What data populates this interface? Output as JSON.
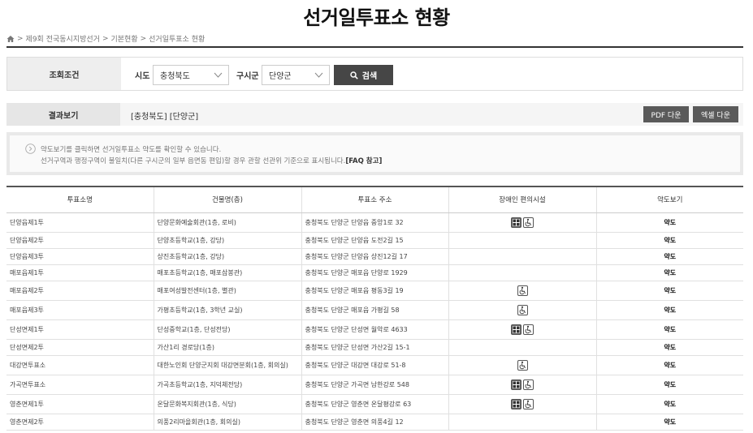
{
  "page": {
    "title": "선거일투표소 현황"
  },
  "breadcrumb": [
    "제9회 전국동시지방선거",
    "기본현황",
    "선거일투표소 현황"
  ],
  "search": {
    "label": "조회조건",
    "sido_label": "시도",
    "sido_value": "충청북도",
    "sigungu_label": "구시군",
    "sigungu_value": "단양군",
    "button_label": "검색"
  },
  "result": {
    "label": "결과보기",
    "region": "[충청북도] [단양군]",
    "pdf_label": "PDF 다운",
    "excel_label": "엑셀 다운"
  },
  "notice": {
    "line1": "약도보기를 클릭하면 선거일투표소 약도를 확인할 수 있습니다.",
    "line2": "선거구역과 행정구역이 불일치(다른 구시군의 일부 읍면동 편입)할 경우 관할 선관위 기준으로 표시됩니다.",
    "faq_link": "[FAQ 참고]"
  },
  "table": {
    "headers": [
      "투표소명",
      "건물명(층)",
      "투표소 주소",
      "장애인 편의시설",
      "약도보기"
    ],
    "rows": [
      {
        "name": "단양읍제1투",
        "building": "단양문화예술회관(1층, 로비)",
        "address": "충청북도 단양군 단양읍 중앙1로 32",
        "facilities": [
          "elevator",
          "wheelchair"
        ],
        "map": "약도"
      },
      {
        "name": "단양읍제2투",
        "building": "단양초등학교(1층, 강당)",
        "address": "충청북도 단양군 단양읍 도전2길 15",
        "facilities": [],
        "map": "약도"
      },
      {
        "name": "단양읍제3투",
        "building": "상진초등학교(1층, 강당)",
        "address": "충청북도 단양군 단양읍 상진12길 17",
        "facilities": [],
        "map": "약도"
      },
      {
        "name": "매포읍제1투",
        "building": "매포초등학교(1층, 매포삼봉관)",
        "address": "충청북도 단양군 매포읍 단양로 1929",
        "facilities": [],
        "map": "약도"
      },
      {
        "name": "매포읍제2투",
        "building": "매포여성발전센터(1층, 별관)",
        "address": "충청북도 단양군 매포읍 평동3길 19",
        "facilities": [
          "wheelchair"
        ],
        "map": "약도"
      },
      {
        "name": "매포읍제3투",
        "building": "가평초등학교(1층, 3학년 교실)",
        "address": "충청북도 단양군 매포읍 가평길 58",
        "facilities": [
          "wheelchair"
        ],
        "map": "약도"
      },
      {
        "name": "단성면제1투",
        "building": "단성중학교(1층, 단성전당)",
        "address": "충청북도 단양군 단성면 월악로 4633",
        "facilities": [
          "elevator",
          "wheelchair"
        ],
        "map": "약도"
      },
      {
        "name": "단성면제2투",
        "building": "가산1리 경로당(1층)",
        "address": "충청북도 단양군 단성면 가산2길 15-1",
        "facilities": [],
        "map": "약도"
      },
      {
        "name": "대강면투표소",
        "building": "대한노인회 단양군지회 대강면분회(1층, 회의실)",
        "address": "충청북도 단양군 대강면 대강로 51-8",
        "facilities": [
          "wheelchair"
        ],
        "map": "약도"
      },
      {
        "name": "가곡면투표소",
        "building": "가곡초등학교(1층, 지덕체전당)",
        "address": "충청북도 단양군 가곡면 남한강로 548",
        "facilities": [
          "elevator",
          "wheelchair"
        ],
        "map": "약도"
      },
      {
        "name": "영춘면제1투",
        "building": "온달문화복지회관(1층, 식당)",
        "address": "충청북도 단양군 영춘면 온달평강로 63",
        "facilities": [
          "elevator",
          "wheelchair"
        ],
        "map": "약도"
      },
      {
        "name": "영춘면제2투",
        "building": "의풍2리마을회관(1층, 회의실)",
        "address": "충청북도 단양군 영춘면 의풍4길 12",
        "facilities": [],
        "map": "약도"
      }
    ]
  }
}
